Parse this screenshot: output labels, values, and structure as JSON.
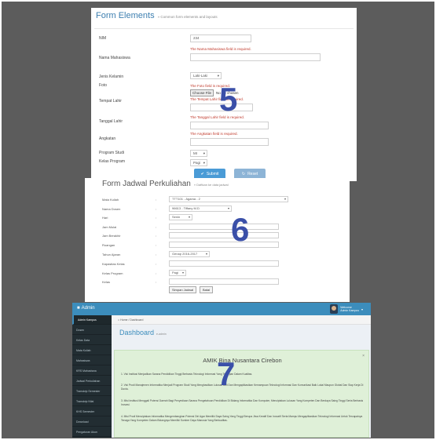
{
  "background_color": "#5c5c5c",
  "panel5": {
    "number_label": "5",
    "title": "Form Elements",
    "subtitle": "» Common form elements and layouts",
    "fields": {
      "nim": {
        "label": "NIM",
        "value": "234"
      },
      "nama": {
        "label": "Nama Mahasiswa",
        "error": "The Nama Mahasiswa field is required."
      },
      "jenis_kelamin": {
        "label": "Jenis Kelamin",
        "value": "Laki-Laki"
      },
      "foto": {
        "label": "Foto",
        "error": "The Foto field is required.",
        "choose_file": "Choose File",
        "no_file": "No file chosen"
      },
      "tempat_lahir": {
        "label": "Tempat Lahir",
        "error": "The Tempat Lahir field is required."
      },
      "tanggal_lahir": {
        "label": "Tanggal Lahir",
        "error": "The Tanggal Lahir field is required."
      },
      "angkatan": {
        "label": "Angkatan",
        "error": "The Angkatan field is required."
      },
      "program_studi": {
        "label": "Program Studi",
        "value": "MI"
      },
      "kelas_program": {
        "label": "Kelas Program",
        "value": "Pagi"
      }
    },
    "submit_label": "Submit",
    "reset_label": "Reset"
  },
  "panel6": {
    "number_label": "6",
    "title": "Form Jadwal Perkuliahan",
    "subtitle": "» Daftkan ke data jadwal",
    "colon": ":",
    "fields": {
      "mata_kuliah": {
        "label": "Mata Kuliah",
        "value": "TTT101 - Agama - 2"
      },
      "nama_dosen": {
        "label": "Nama Dosen",
        "value": "96613 - Tiffany M.D"
      },
      "hari": {
        "label": "Hari",
        "value": "Senin"
      },
      "jam_mulai": {
        "label": "Jam Mulai"
      },
      "jam_berakhir": {
        "label": "Jam Berakhir"
      },
      "ruangan": {
        "label": "Ruangan"
      },
      "tahun_ajaran": {
        "label": "Tahun Ajaran",
        "value": "Genap 2016-2017"
      },
      "kapasitas_kelas": {
        "label": "Kapasitas Kelas"
      },
      "kelas_program": {
        "label": "Kelas Program",
        "value": "Pagi"
      },
      "kelas": {
        "label": "Kelas"
      }
    },
    "save_label": "Simpan Jadwal",
    "reset_label": "Batal"
  },
  "panel7": {
    "number_label": "7",
    "brand": "Admin",
    "user_name": "Welcome",
    "user_role": "Admin Kampus",
    "breadcrumb": "Home / Dashboard",
    "dashboard_title": "Dashboard",
    "dashboard_subtitle": "e-admin",
    "sidebar_items": [
      "Admin Kampus",
      "Dosen",
      "Kelas Data",
      "Mata Kuliah",
      "Mahasiswa",
      "KRS Mahasiswa",
      "Jadwal Perkuliahan",
      "Transkrip Semester",
      "Transkrip Nilai",
      "KHS Semester",
      "Download",
      "Pengaturan Akun"
    ],
    "callout_title": "AMIK Bina Nusantara Cirebon",
    "close_symbol": "×",
    "paragraphs": [
      "1. Visi Institusi Menjadikan Sarana Pendidikan Tinggi Berbasis Teknologi Informasi Yang Terdepan Dalam Kualitas.",
      "2. Visi Prodi Manajemen Informatika Menjadi Program Studi Yang Menghasilkan Lulusan Ahli Dan Mengaplikasikan Kemampuan Teknologi Informasi Dan Komunikasi Baik Lokal Maupun Global Dan Siap Kerja Di Dunia.",
      "3. Misi Institusi Menggali Potensi Daerah Bagi Penyediaan Sarana Pengetahuan Pendidikan Di Bidang Informatika Dan Komputer, Menciptakan Lulusan Yang Kompeten Dan Berdaya Saing Tinggi Serta Berbasis Inovasi.",
      "4. Misi Prodi Menciptakan Informatika Mengembangkan Potensi Diri Agar Memiliki Daya Saing Yang Tinggi Berupa Jiwa Kreatif Dan Inovatif Serta Mampu Mengaplikasikan Teknologi Informasi Untuk Tercapainya Tenaga Yang Kompeten Dalam Bidangnya Memiliki Sumber Daya Manusia Yang Berkualitas."
    ]
  }
}
